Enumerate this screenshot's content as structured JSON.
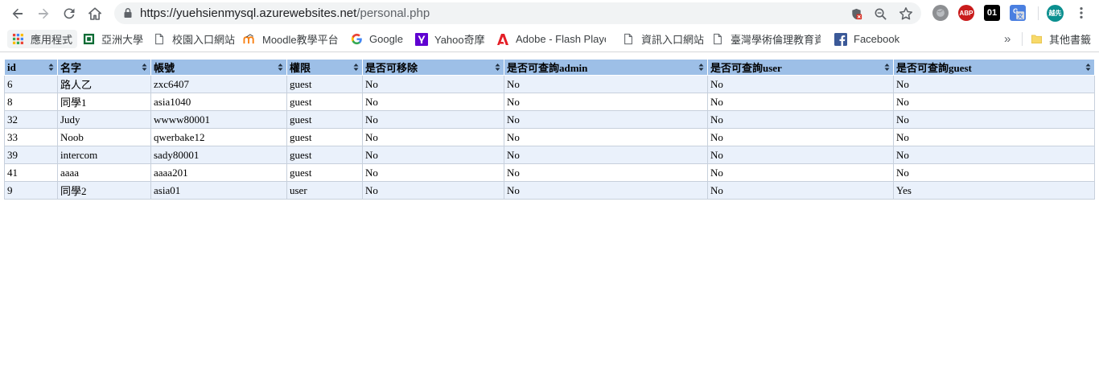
{
  "browser": {
    "url_host": "https://yuehsienmysql.azurewebsites.net",
    "url_path": "/personal.php"
  },
  "extensions": [
    {
      "name": "abp-icon",
      "label": "ABP",
      "color": "#c91c1c"
    },
    {
      "name": "01-extension-icon",
      "label": "01",
      "color": "#000000"
    }
  ],
  "profile": {
    "label": "越先",
    "color": "#0b8f8f"
  },
  "bookmarks": {
    "items": [
      {
        "label": "應用程式",
        "icon": "apps-grid-icon"
      },
      {
        "label": "亞洲大學",
        "icon": "asia-univ-icon"
      },
      {
        "label": "校園入口網站",
        "icon": "page-icon"
      },
      {
        "label": "Moodle教學平台",
        "icon": "moodle-icon"
      },
      {
        "label": "Google",
        "icon": "google-icon"
      },
      {
        "label": "Yahoo奇摩",
        "icon": "yahoo-icon"
      },
      {
        "label": "Adobe - Flash Playe",
        "icon": "adobe-icon"
      },
      {
        "label": "資訊入口網站",
        "icon": "page-icon"
      },
      {
        "label": "臺灣學術倫理教育資",
        "icon": "page-icon"
      },
      {
        "label": "Facebook",
        "icon": "facebook-icon"
      }
    ],
    "overflow": "»",
    "other": "其他書籤"
  },
  "table": {
    "columns": [
      "id",
      "名字",
      "帳號",
      "權限",
      "是否可移除",
      "是否可查詢admin",
      "是否可查詢user",
      "是否可查詢guest"
    ],
    "rows": [
      [
        "6",
        "路人乙",
        "zxc6407",
        "guest",
        "No",
        "No",
        "No",
        "No"
      ],
      [
        "8",
        "同學1",
        "asia1040",
        "guest",
        "No",
        "No",
        "No",
        "No"
      ],
      [
        "32",
        "Judy",
        "wwww80001",
        "guest",
        "No",
        "No",
        "No",
        "No"
      ],
      [
        "33",
        "Noob",
        "qwerbake12",
        "guest",
        "No",
        "No",
        "No",
        "No"
      ],
      [
        "39",
        "intercom",
        "sady80001",
        "guest",
        "No",
        "No",
        "No",
        "No"
      ],
      [
        "41",
        "aaaa",
        "aaaa201",
        "guest",
        "No",
        "No",
        "No",
        "No"
      ],
      [
        "9",
        "同學2",
        "asia01",
        "user",
        "No",
        "No",
        "No",
        "Yes"
      ]
    ]
  }
}
